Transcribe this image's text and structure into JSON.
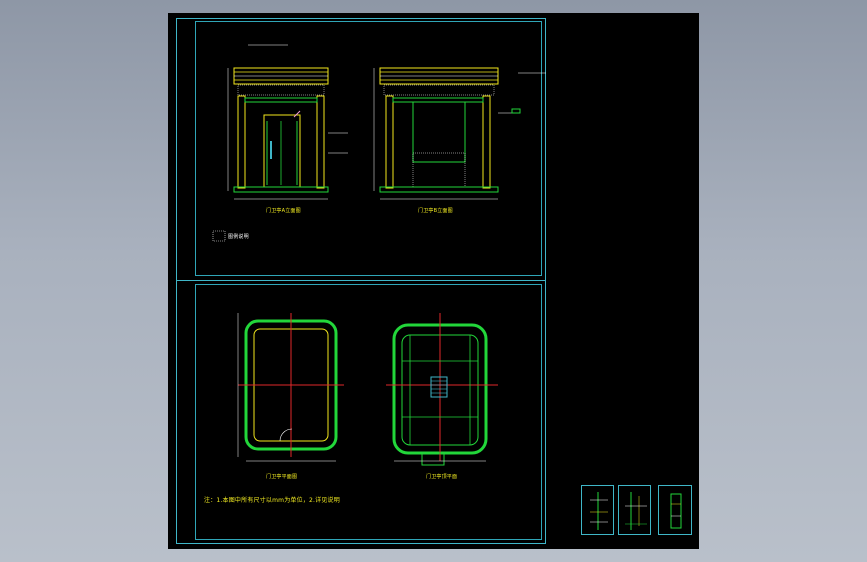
{
  "drawing": {
    "view_titles": [
      "门卫亭A立面图",
      "门卫亭B立面图",
      "门卫亭平面图",
      "门卫亭顶平面"
    ],
    "note": "注：1.本图中所有尺寸以mm为单位，2.详见说明",
    "legend_text": "图例说明"
  },
  "colors": {
    "background": "#000000",
    "frame": "#3fb6c8",
    "wall": "#22d63a",
    "column": "#f3e81d",
    "axis": "#e0282a",
    "annotation": "#ffffff",
    "accent": "#f29ad6"
  },
  "thumbnails": [
    "sheet-thumb-1",
    "sheet-thumb-2",
    "sheet-thumb-3"
  ]
}
